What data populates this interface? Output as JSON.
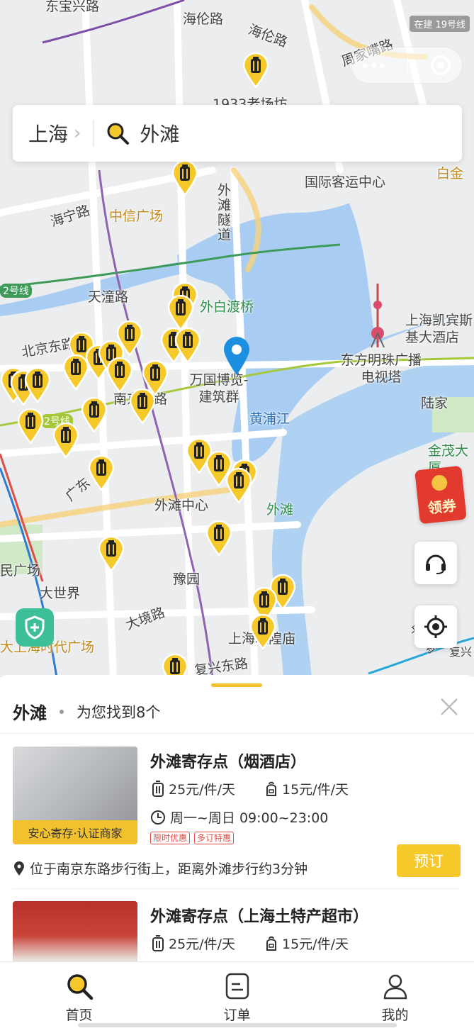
{
  "status_bar": {
    "badge": "在建 19号线"
  },
  "search": {
    "city": "上海",
    "chevron": "›",
    "keyword": "外滩"
  },
  "map": {
    "labels": {
      "dongbaoxing": "东宝兴路",
      "hailunlu": "海伦路",
      "hailunlu2": "海伦路",
      "zhoujiazui": "周家嘴路",
      "old_1933": "1933老场坊",
      "intl_terminal": "国际客运中心",
      "baijin": "白金",
      "haining": "海宁路",
      "citic": "中信广场",
      "waitan_tunnel": "外滩隧道",
      "line2_left": "2号线",
      "tiantong": "天潼路",
      "waibaidu": "外白渡桥",
      "kerry": "上海凯宾斯基大酒店",
      "oriental_pearl": "东方明珠广播电视塔",
      "wanguo": "万国博览-建筑群",
      "nanjing_east": "南京东路",
      "lujiazui": "陆家",
      "huangpu": "黄浦江",
      "line2_mid": "2号线",
      "beijing_east": "北京东路",
      "jinmao": "金茂大厦",
      "guangdong": "广东",
      "bund_center": "外滩中心",
      "waitan": "外滩",
      "renmin": "民广场",
      "dashijie": "大世界",
      "yuyuan": "豫园",
      "dajing": "大境路",
      "chenghuang": "上海城隍庙",
      "shidai": "大上海时代广场",
      "fuxing": "复兴东路",
      "zhongshan": "中山南",
      "fuxing2": "复兴"
    },
    "coupon": "领券"
  },
  "sheet": {
    "title": "外滩",
    "result_count": "为您找到8个",
    "stores": [
      {
        "name": "外滩寄存点（烟酒店）",
        "price_large": "25元/件/天",
        "price_small": "15元/件/天",
        "hours": "周一~周日 09:00~23:00",
        "badge": "安心寄存·认证商家",
        "tags": [
          "限时优惠",
          "多订特惠"
        ],
        "location": "位于南京东路步行街上，距离外滩步行约3分钟",
        "book": "预订"
      },
      {
        "name": "外滩寄存点（上海土特产超市）",
        "price_large": "25元/件/天",
        "price_small": "15元/件/天"
      }
    ]
  },
  "tabbar": {
    "home": "首页",
    "orders": "订单",
    "mine": "我的"
  },
  "colors": {
    "accent": "#f5c92a",
    "water": "#a9cdf2",
    "park": "#cfe8c6"
  }
}
